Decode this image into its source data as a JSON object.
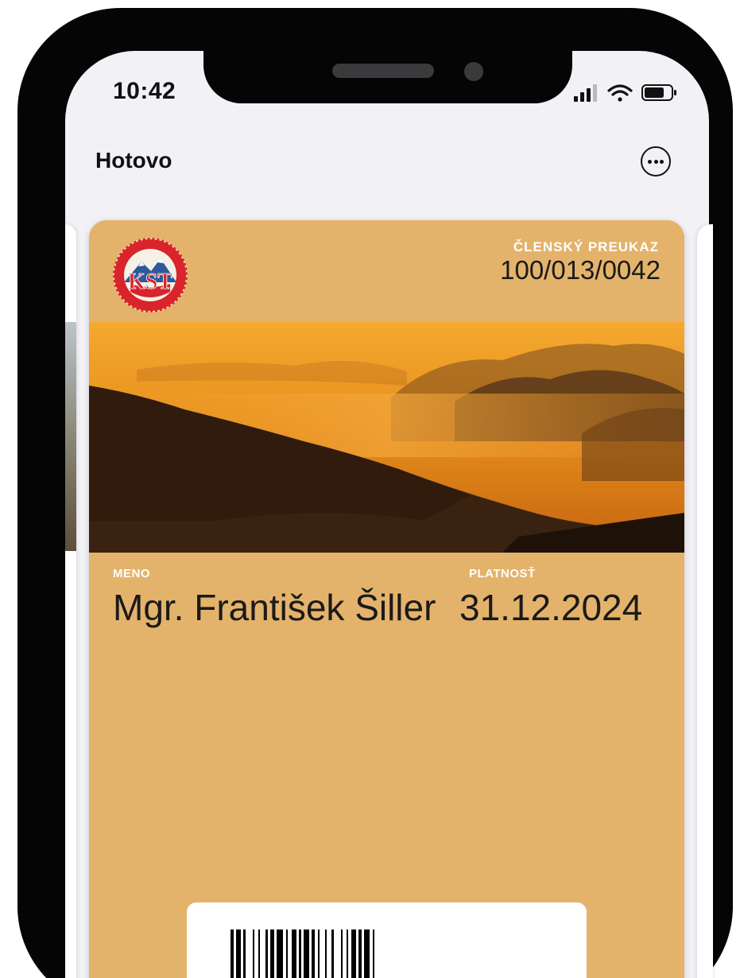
{
  "status_bar": {
    "time": "10:42"
  },
  "nav": {
    "done_label": "Hotovo",
    "more_icon": "ellipsis-circle-icon"
  },
  "pass": {
    "background_color": "#e4b36b",
    "header": {
      "label": "ČLENSKÝ PREUKAZ",
      "value": "100/013/0042"
    },
    "fields": [
      {
        "label": "MENO",
        "value": "Mgr. František Šiller"
      },
      {
        "label": "PLATNOSŤ",
        "value": "31.12.2024"
      }
    ],
    "logo_icon": "kst-club-logo-icon",
    "strip_image": "mountain-sunset-image",
    "barcode_icon": "barcode-icon"
  }
}
